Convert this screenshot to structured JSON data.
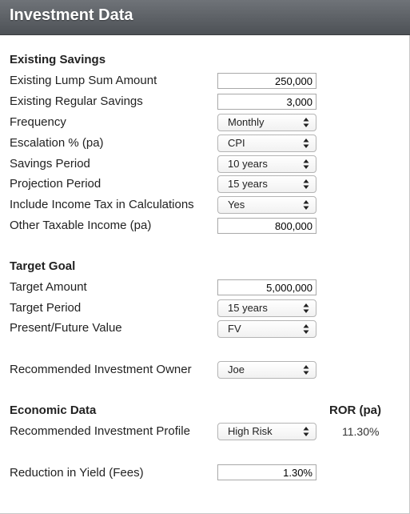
{
  "header": {
    "title": "Investment Data"
  },
  "existing_savings": {
    "heading": "Existing Savings",
    "lump_sum": {
      "label": "Existing Lump Sum Amount",
      "value": "250,000"
    },
    "regular_savings": {
      "label": "Existing Regular Savings",
      "value": "3,000"
    },
    "frequency": {
      "label": "Frequency",
      "value": "Monthly"
    },
    "escalation": {
      "label": "Escalation % (pa)",
      "value": "CPI"
    },
    "savings_period": {
      "label": "Savings Period",
      "value": "10 years"
    },
    "projection_period": {
      "label": "Projection Period",
      "value": "15 years"
    },
    "income_tax": {
      "label": "Include Income Tax in Calculations",
      "value": "Yes"
    },
    "other_income": {
      "label": "Other Taxable Income (pa)",
      "value": "800,000"
    }
  },
  "target_goal": {
    "heading": "Target Goal",
    "target_amount": {
      "label": "Target Amount",
      "value": "5,000,000"
    },
    "target_period": {
      "label": "Target Period",
      "value": "15 years"
    },
    "present_future": {
      "label": "Present/Future Value",
      "value": "FV"
    }
  },
  "owner": {
    "label": "Recommended Investment Owner",
    "value": "Joe"
  },
  "economic_data": {
    "heading": "Economic Data",
    "ror_heading": "ROR (pa)",
    "profile": {
      "label": "Recommended Investment Profile",
      "value": "High Risk",
      "ror": "11.30%"
    }
  },
  "fees": {
    "label": "Reduction in Yield (Fees)",
    "value": "1.30%"
  },
  "icons": {
    "select_arrows": "up-down-chevron-icon"
  }
}
